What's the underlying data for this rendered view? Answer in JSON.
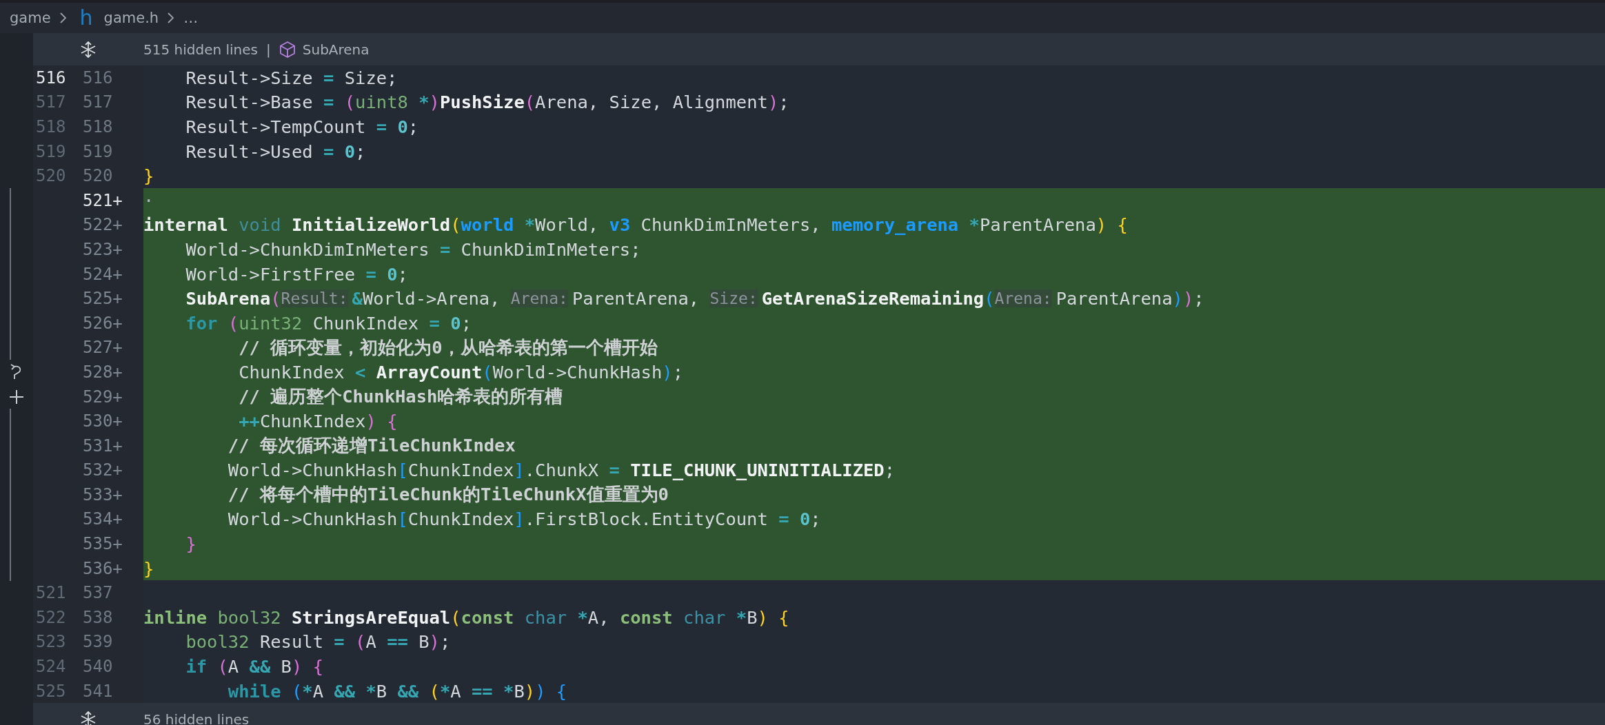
{
  "breadcrumb": {
    "items": [
      {
        "text": "game"
      },
      {
        "badge": "h",
        "text": "game.h"
      },
      {
        "text": "…"
      }
    ]
  },
  "top_fold": {
    "text": "515 hidden lines",
    "separator": "|",
    "symbol": "SubArena"
  },
  "lines": [
    {
      "old": {
        "text": "516",
        "active": true
      },
      "new": {
        "text": "516",
        "active": false
      },
      "added": false,
      "tokens": [
        {
          "kind": "plain",
          "text": "    Result->Size "
        },
        {
          "kind": "op",
          "text": "="
        },
        {
          "kind": "plain",
          "text": " Size;"
        }
      ]
    },
    {
      "old": {
        "text": "517",
        "active": false
      },
      "new": {
        "text": "517",
        "active": false
      },
      "added": false,
      "tokens": [
        {
          "kind": "plain",
          "text": "    Result->Base "
        },
        {
          "kind": "op",
          "text": "= "
        },
        {
          "kind": "p2",
          "text": "("
        },
        {
          "kind": "type",
          "text": "uint8 "
        },
        {
          "kind": "op",
          "text": "*"
        },
        {
          "kind": "p2",
          "text": ")"
        },
        {
          "kind": "fn",
          "text": "PushSize"
        },
        {
          "kind": "p2",
          "text": "("
        },
        {
          "kind": "plain",
          "text": "Arena, Size, Alignment"
        },
        {
          "kind": "p2",
          "text": ")"
        },
        {
          "kind": "plain",
          "text": ";"
        }
      ]
    },
    {
      "old": {
        "text": "518",
        "active": false
      },
      "new": {
        "text": "518",
        "active": false
      },
      "added": false,
      "tokens": [
        {
          "kind": "plain",
          "text": "    Result->TempCount "
        },
        {
          "kind": "op",
          "text": "= "
        },
        {
          "kind": "num",
          "text": "0"
        },
        {
          "kind": "plain",
          "text": ";"
        }
      ]
    },
    {
      "old": {
        "text": "519",
        "active": false
      },
      "new": {
        "text": "519",
        "active": false
      },
      "added": false,
      "tokens": [
        {
          "kind": "plain",
          "text": "    Result->Used "
        },
        {
          "kind": "op",
          "text": "= "
        },
        {
          "kind": "num",
          "text": "0"
        },
        {
          "kind": "plain",
          "text": ";"
        }
      ]
    },
    {
      "old": {
        "text": "520",
        "active": false
      },
      "new": {
        "text": "520",
        "active": false
      },
      "added": false,
      "tokens": [
        {
          "kind": "p1",
          "text": "}"
        }
      ]
    },
    {
      "new": {
        "text": "521",
        "active": true
      },
      "sign": "+",
      "added": true,
      "tokens": [
        {
          "kind": "ws",
          "text": "·"
        }
      ]
    },
    {
      "new": {
        "text": "522",
        "active": false
      },
      "sign": "+",
      "added": true,
      "tokens": [
        {
          "kind": "storage",
          "text": "internal "
        },
        {
          "kind": "void",
          "text": "void "
        },
        {
          "kind": "fn",
          "text": "InitializeWorld"
        },
        {
          "kind": "p1",
          "text": "("
        },
        {
          "kind": "utype",
          "text": "world "
        },
        {
          "kind": "op",
          "text": "*"
        },
        {
          "kind": "plain",
          "text": "World, "
        },
        {
          "kind": "utype",
          "text": "v3"
        },
        {
          "kind": "plain",
          "text": " ChunkDimInMeters, "
        },
        {
          "kind": "utype",
          "text": "memory_arena "
        },
        {
          "kind": "op",
          "text": "*"
        },
        {
          "kind": "plain",
          "text": "ParentArena"
        },
        {
          "kind": "p1",
          "text": ") {"
        }
      ]
    },
    {
      "new": {
        "text": "523",
        "active": false
      },
      "sign": "+",
      "added": true,
      "tokens": [
        {
          "kind": "plain",
          "text": "    World->ChunkDimInMeters "
        },
        {
          "kind": "op",
          "text": "="
        },
        {
          "kind": "plain",
          "text": " ChunkDimInMeters;"
        }
      ]
    },
    {
      "new": {
        "text": "524",
        "active": false
      },
      "sign": "+",
      "added": true,
      "tokens": [
        {
          "kind": "plain",
          "text": "    World->FirstFree "
        },
        {
          "kind": "op",
          "text": "= "
        },
        {
          "kind": "num",
          "text": "0"
        },
        {
          "kind": "plain",
          "text": ";"
        }
      ]
    },
    {
      "new": {
        "text": "525",
        "active": false
      },
      "sign": "+",
      "added": true,
      "tokens": [
        {
          "kind": "fn",
          "text": "    SubArena"
        },
        {
          "kind": "p2",
          "text": "("
        },
        {
          "kind": "hint",
          "text": "Result:"
        },
        {
          "kind": "op",
          "text": "&"
        },
        {
          "kind": "plain",
          "text": "World->Arena, "
        },
        {
          "kind": "hint",
          "text": "Arena:"
        },
        {
          "kind": "plain",
          "text": "ParentArena, "
        },
        {
          "kind": "hint",
          "text": "Size:"
        },
        {
          "kind": "fn",
          "text": "GetArenaSizeRemaining"
        },
        {
          "kind": "p3",
          "text": "("
        },
        {
          "kind": "hint",
          "text": "Arena:"
        },
        {
          "kind": "plain",
          "text": "ParentArena"
        },
        {
          "kind": "p3",
          "text": ")"
        },
        {
          "kind": "p2",
          "text": ")"
        },
        {
          "kind": "plain",
          "text": ";"
        }
      ]
    },
    {
      "new": {
        "text": "526",
        "active": false
      },
      "sign": "+",
      "added": true,
      "tokens": [
        {
          "kind": "kw",
          "text": "    for "
        },
        {
          "kind": "p2",
          "text": "("
        },
        {
          "kind": "type",
          "text": "uint32"
        },
        {
          "kind": "plain",
          "text": " ChunkIndex "
        },
        {
          "kind": "op",
          "text": "= "
        },
        {
          "kind": "num",
          "text": "0"
        },
        {
          "kind": "plain",
          "text": ";"
        }
      ]
    },
    {
      "new": {
        "text": "527",
        "active": false
      },
      "sign": "+",
      "added": true,
      "tokens": [
        {
          "kind": "comment",
          "text": "         // 循环变量，初始化为0，从哈希表的第一个槽开始"
        }
      ]
    },
    {
      "new": {
        "text": "528",
        "active": false
      },
      "sign": "+",
      "added": true,
      "gutter": {
        "kind": "undo"
      },
      "tokens": [
        {
          "kind": "plain",
          "text": "         ChunkIndex "
        },
        {
          "kind": "op",
          "text": "< "
        },
        {
          "kind": "fn",
          "text": "ArrayCount"
        },
        {
          "kind": "p3",
          "text": "("
        },
        {
          "kind": "plain",
          "text": "World->ChunkHash"
        },
        {
          "kind": "p3",
          "text": ")"
        },
        {
          "kind": "plain",
          "text": ";"
        }
      ]
    },
    {
      "new": {
        "text": "529",
        "active": false
      },
      "sign": "+",
      "added": true,
      "gutter": {
        "kind": "plus"
      },
      "tokens": [
        {
          "kind": "comment",
          "text": "         // 遍历整个ChunkHash哈希表的所有槽"
        }
      ]
    },
    {
      "new": {
        "text": "530",
        "active": false
      },
      "sign": "+",
      "added": true,
      "tokens": [
        {
          "kind": "op",
          "text": "         ++"
        },
        {
          "kind": "plain",
          "text": "ChunkIndex"
        },
        {
          "kind": "p2",
          "text": ") {"
        }
      ]
    },
    {
      "new": {
        "text": "531",
        "active": false
      },
      "sign": "+",
      "added": true,
      "tokens": [
        {
          "kind": "comment",
          "text": "        // 每次循环递增TileChunkIndex"
        }
      ]
    },
    {
      "new": {
        "text": "532",
        "active": false
      },
      "sign": "+",
      "added": true,
      "tokens": [
        {
          "kind": "plain",
          "text": "        World->ChunkHash"
        },
        {
          "kind": "p3",
          "text": "["
        },
        {
          "kind": "plain",
          "text": "ChunkIndex"
        },
        {
          "kind": "p3",
          "text": "]"
        },
        {
          "kind": "plain",
          "text": ".ChunkX "
        },
        {
          "kind": "op",
          "text": "= "
        },
        {
          "kind": "fn",
          "text": "TILE_CHUNK_UNINITIALIZED"
        },
        {
          "kind": "plain",
          "text": ";"
        }
      ]
    },
    {
      "new": {
        "text": "533",
        "active": false
      },
      "sign": "+",
      "added": true,
      "tokens": [
        {
          "kind": "comment",
          "text": "        // 将每个槽中的TileChunk的TileChunkX值重置为0"
        }
      ]
    },
    {
      "new": {
        "text": "534",
        "active": false
      },
      "sign": "+",
      "added": true,
      "tokens": [
        {
          "kind": "plain",
          "text": "        World->ChunkHash"
        },
        {
          "kind": "p3",
          "text": "["
        },
        {
          "kind": "plain",
          "text": "ChunkIndex"
        },
        {
          "kind": "p3",
          "text": "]"
        },
        {
          "kind": "plain",
          "text": ".FirstBlock.EntityCount "
        },
        {
          "kind": "op",
          "text": "= "
        },
        {
          "kind": "num",
          "text": "0"
        },
        {
          "kind": "plain",
          "text": ";"
        }
      ]
    },
    {
      "new": {
        "text": "535",
        "active": false
      },
      "sign": "+",
      "added": true,
      "tokens": [
        {
          "kind": "p2",
          "text": "    }"
        }
      ]
    },
    {
      "new": {
        "text": "536",
        "active": false
      },
      "sign": "+",
      "added": true,
      "tokens": [
        {
          "kind": "p1",
          "text": "}"
        }
      ]
    },
    {
      "old": {
        "text": "521",
        "active": false
      },
      "new": {
        "text": "537",
        "active": false
      },
      "added": false
    },
    {
      "old": {
        "text": "522",
        "active": false
      },
      "new": {
        "text": "538",
        "active": false
      },
      "added": false,
      "tokens": [
        {
          "kind": "kw2",
          "text": "inline "
        },
        {
          "kind": "type",
          "text": "bool32 "
        },
        {
          "kind": "fn",
          "text": "StringsAreEqual"
        },
        {
          "kind": "p1",
          "text": "("
        },
        {
          "kind": "kw2",
          "text": "const "
        },
        {
          "kind": "type2",
          "text": "char "
        },
        {
          "kind": "op",
          "text": "*"
        },
        {
          "kind": "plain",
          "text": "A, "
        },
        {
          "kind": "kw2",
          "text": "const "
        },
        {
          "kind": "type2",
          "text": "char "
        },
        {
          "kind": "op",
          "text": "*"
        },
        {
          "kind": "plain",
          "text": "B"
        },
        {
          "kind": "p1",
          "text": ") {"
        }
      ]
    },
    {
      "old": {
        "text": "523",
        "active": false
      },
      "new": {
        "text": "539",
        "active": false
      },
      "added": false,
      "tokens": [
        {
          "kind": "type",
          "text": "    bool32"
        },
        {
          "kind": "plain",
          "text": " Result "
        },
        {
          "kind": "op",
          "text": "= "
        },
        {
          "kind": "p2",
          "text": "("
        },
        {
          "kind": "plain",
          "text": "A "
        },
        {
          "kind": "op",
          "text": "=="
        },
        {
          "kind": "plain",
          "text": " B"
        },
        {
          "kind": "p2",
          "text": ")"
        },
        {
          "kind": "plain",
          "text": ";"
        }
      ]
    },
    {
      "old": {
        "text": "524",
        "active": false
      },
      "new": {
        "text": "540",
        "active": false
      },
      "added": false,
      "tokens": [
        {
          "kind": "kw",
          "text": "    if "
        },
        {
          "kind": "p2",
          "text": "("
        },
        {
          "kind": "plain",
          "text": "A "
        },
        {
          "kind": "op",
          "text": "&&"
        },
        {
          "kind": "plain",
          "text": " B"
        },
        {
          "kind": "p2",
          "text": ") {"
        }
      ]
    },
    {
      "old": {
        "text": "525",
        "active": false
      },
      "new": {
        "text": "541",
        "active": false
      },
      "added": false,
      "tokens": [
        {
          "kind": "kw",
          "text": "        while "
        },
        {
          "kind": "p3",
          "text": "("
        },
        {
          "kind": "op",
          "text": "*"
        },
        {
          "kind": "plain",
          "text": "A "
        },
        {
          "kind": "op",
          "text": "&& *"
        },
        {
          "kind": "plain",
          "text": "B "
        },
        {
          "kind": "op",
          "text": "&& "
        },
        {
          "kind": "p1",
          "text": "("
        },
        {
          "kind": "op",
          "text": "*"
        },
        {
          "kind": "plain",
          "text": "A "
        },
        {
          "kind": "op",
          "text": "== *"
        },
        {
          "kind": "plain",
          "text": "B"
        },
        {
          "kind": "p1",
          "text": ")"
        },
        {
          "kind": "p3",
          "text": ") {"
        }
      ]
    }
  ],
  "bottom_fold": {
    "text": "56 hidden lines"
  }
}
